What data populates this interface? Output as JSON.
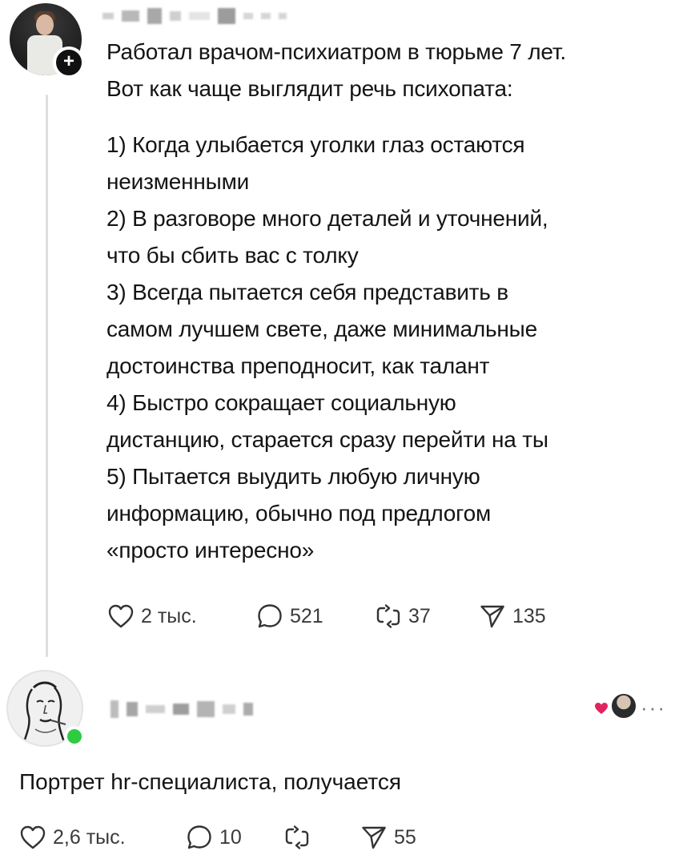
{
  "post": {
    "lines": [
      "Работал врачом-психиатром в тюрьме 7 лет.",
      "Вот как чаще выглядит речь психопата:",
      "1) Когда улыбается уголки глаз остаются",
      "неизменными",
      "2) В разговоре много деталей и уточнений,",
      "что бы сбить вас с толку",
      "3) Всегда пытается себя представить в",
      "самом лучшем свете, даже минимальные",
      "достоинства преподносит, как талант",
      "4) Быстро сокращает социальную",
      "дистанцию, старается сразу перейти на ты",
      "5) Пытается выудить любую личную",
      "информацию, обычно под предлогом",
      "«просто интересно»"
    ],
    "actions": {
      "likes": "2 тыс.",
      "comments": "521",
      "reposts": "37",
      "shares": "135"
    },
    "follow_symbol": "+"
  },
  "reply": {
    "text": "Портрет hr-специалиста, получается",
    "more": "···",
    "actions": {
      "likes": "2,6 тыс.",
      "comments": "10",
      "reposts": "",
      "shares": "55"
    }
  },
  "colors": {
    "online": "#2ecc40",
    "heart": "#e0245e",
    "thread_line": "#dedede"
  },
  "icons": [
    "heart-icon",
    "comment-icon",
    "repost-icon",
    "share-icon",
    "plus-icon",
    "more-icon"
  ]
}
